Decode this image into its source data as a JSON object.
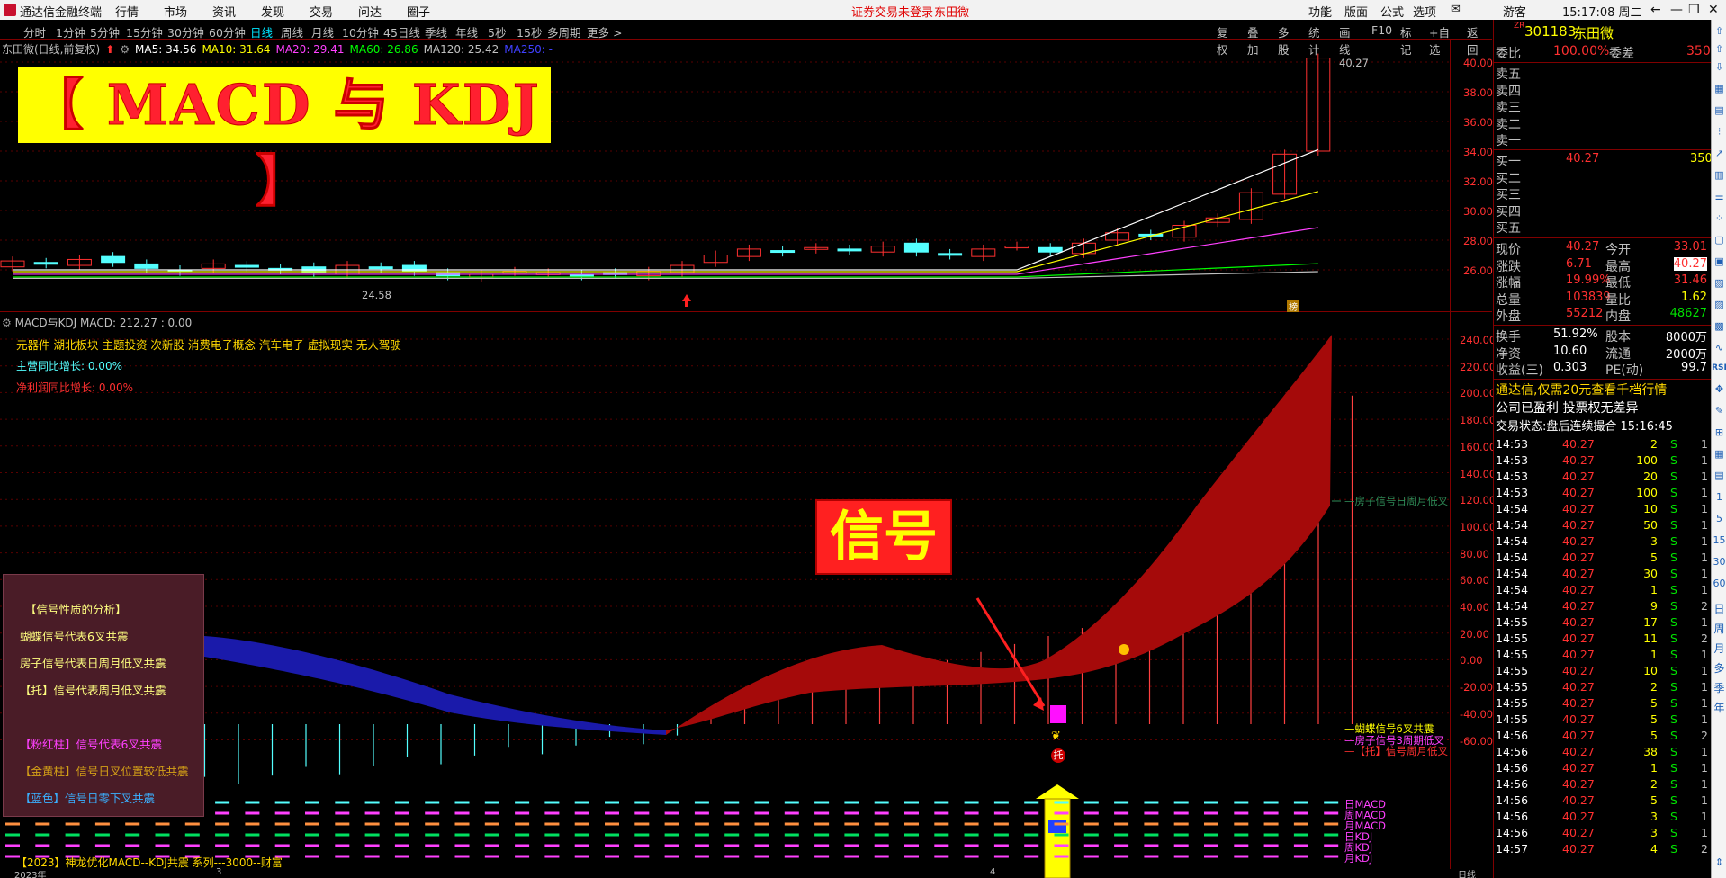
{
  "titlebar": {
    "app_name": "通达信金融终端",
    "menu": [
      "行情",
      "市场",
      "资讯",
      "发现",
      "交易",
      "问达",
      "圈子"
    ],
    "warning": "证券交易未登录",
    "stock": "东田微",
    "right": [
      "功能",
      "版面",
      "公式",
      "选项"
    ],
    "user": "游客",
    "time": "15:17:08 周二"
  },
  "timeframes": [
    "分时",
    "1分钟",
    "5分钟",
    "15分钟",
    "30分钟",
    "60分钟",
    "日线",
    "周线",
    "月线",
    "10分钟",
    "45日线",
    "季线",
    "年线",
    "5秒",
    "15秒",
    "多周期",
    "更多 >"
  ],
  "active_timeframe": "日线",
  "toolbar_right": [
    "复权",
    "叠加",
    "多股",
    "统计",
    "画线",
    "F10",
    "标记",
    "+自选",
    "返回"
  ],
  "ma_line": {
    "name": "东田微(日线,前复权)",
    "ma5": "MA5: 34.56",
    "ma10": "MA10: 31.64",
    "ma20": "MA20: 29.41",
    "ma60": "MA60: 26.86",
    "ma120": "MA120: 25.42",
    "ma250": "MA250: -"
  },
  "banner": "【 MACD 与 KDJ 】",
  "price_axis": [
    "40.00",
    "38.00",
    "36.00",
    "34.00",
    "32.00",
    "30.00",
    "28.00",
    "26.00"
  ],
  "high_label": "40.27",
  "low_label": "24.58",
  "badge_text": "榜",
  "indicator": {
    "title": "MACD与KDJ",
    "macd_label": "MACD: 212.27",
    "macd_extra": ": 0.00",
    "concepts": "元器件 湖北板块 主题投资 次新股 消费电子概念 汽车电子 虚拟现实 无人驾驶",
    "revenue_growth": "主营同比增长: 0.00%",
    "profit_growth": "净利润同比增长: 0.00%"
  },
  "macd_axis": [
    "240.00",
    "220.00",
    "200.00",
    "180.00",
    "160.00",
    "140.00",
    "120.00",
    "100.00",
    "80.00",
    "60.00",
    "40.00",
    "20.00",
    "0.00",
    "-20.00",
    "-40.00",
    "-60.00"
  ],
  "signal_box": "信号",
  "legend_box": {
    "title": "【信号性质的分析】",
    "l1": "蝴蝶信号代表6叉共震",
    "l2": "房子信号代表日周月低叉共震",
    "l3": "【托】信号代表周月低叉共震",
    "l4": "【粉红柱】信号代表6叉共震",
    "l5": "【金黄柱】信号日叉位置较低共震",
    "l6": "【蓝色】信号日零下叉共震"
  },
  "right_labels": {
    "house": "—房子信号日周月低叉",
    "butterfly": "—蝴蝶信号6叉共震",
    "house2": "—房子信号3周期低叉",
    "tuo": "—【托】信号周月低叉",
    "tuo_mark": "托",
    "rows": [
      "日MACD",
      "周MACD",
      "月MACD",
      "日KDJ",
      "周KDJ",
      "月KDJ"
    ]
  },
  "bottom_label": "【2023】神龙优化MACD--KDJ共震 系列---3000--财富",
  "date_bar": {
    "year": "2023年",
    "mid": "3",
    "right": "4",
    "axis": "日线"
  },
  "quote": {
    "flag": "ZR",
    "code": "301183",
    "name": "东田微",
    "weibi_label": "委比",
    "weibi": "100.00%",
    "weicha_label": "委差",
    "weicha": "350",
    "sell": [
      "卖五",
      "卖四",
      "卖三",
      "卖二",
      "卖一"
    ],
    "buy": [
      {
        "label": "买一",
        "price": "40.27",
        "vol": "350"
      },
      {
        "label": "买二",
        "price": "",
        "vol": ""
      },
      {
        "label": "买三",
        "price": "",
        "vol": ""
      },
      {
        "label": "买四",
        "price": "",
        "vol": ""
      },
      {
        "label": "买五",
        "price": "",
        "vol": ""
      }
    ],
    "stats": [
      [
        "现价",
        "40.27",
        "今开",
        "33.01"
      ],
      [
        "涨跌",
        "6.71",
        "最高",
        "40.27"
      ],
      [
        "涨幅",
        "19.99%",
        "最低",
        "31.46"
      ],
      [
        "总量",
        "103839",
        "量比",
        "1.62"
      ],
      [
        "外盘",
        "55212",
        "内盘",
        "48627"
      ]
    ],
    "fund": [
      [
        "换手",
        "51.92%",
        "股本",
        "8000万"
      ],
      [
        "净资",
        "10.60",
        "流通",
        "2000万"
      ],
      [
        "收益(三)",
        "0.303",
        "PE(动)",
        "99.7"
      ]
    ],
    "promo1": "通达信,仅需20元查看千档行情",
    "promo2": "公司已盈利 投票权无差异",
    "trade_status": "交易状态:盘后连续撮合 15:16:45"
  },
  "ticks": [
    [
      "14:53",
      "40.27",
      "2",
      "S",
      "1"
    ],
    [
      "14:53",
      "40.27",
      "100",
      "S",
      "1"
    ],
    [
      "14:53",
      "40.27",
      "20",
      "S",
      "1"
    ],
    [
      "14:53",
      "40.27",
      "100",
      "S",
      "1"
    ],
    [
      "14:54",
      "40.27",
      "10",
      "S",
      "1"
    ],
    [
      "14:54",
      "40.27",
      "50",
      "S",
      "1"
    ],
    [
      "14:54",
      "40.27",
      "3",
      "S",
      "1"
    ],
    [
      "14:54",
      "40.27",
      "5",
      "S",
      "1"
    ],
    [
      "14:54",
      "40.27",
      "30",
      "S",
      "1"
    ],
    [
      "14:54",
      "40.27",
      "1",
      "S",
      "1"
    ],
    [
      "14:54",
      "40.27",
      "9",
      "S",
      "2"
    ],
    [
      "14:55",
      "40.27",
      "17",
      "S",
      "1"
    ],
    [
      "14:55",
      "40.27",
      "11",
      "S",
      "2"
    ],
    [
      "14:55",
      "40.27",
      "1",
      "S",
      "1"
    ],
    [
      "14:55",
      "40.27",
      "10",
      "S",
      "1"
    ],
    [
      "14:55",
      "40.27",
      "2",
      "S",
      "1"
    ],
    [
      "14:55",
      "40.27",
      "5",
      "S",
      "1"
    ],
    [
      "14:55",
      "40.27",
      "5",
      "S",
      "1"
    ],
    [
      "14:56",
      "40.27",
      "5",
      "S",
      "2"
    ],
    [
      "14:56",
      "40.27",
      "38",
      "S",
      "1"
    ],
    [
      "14:56",
      "40.27",
      "1",
      "S",
      "1"
    ],
    [
      "14:56",
      "40.27",
      "2",
      "S",
      "1"
    ],
    [
      "14:56",
      "40.27",
      "5",
      "S",
      "1"
    ],
    [
      "14:56",
      "40.27",
      "3",
      "S",
      "1"
    ],
    [
      "14:56",
      "40.27",
      "3",
      "S",
      "1"
    ],
    [
      "14:57",
      "40.27",
      "4",
      "S",
      "2"
    ]
  ],
  "sidebar_text": [
    "日",
    "周",
    "月",
    "多",
    "季",
    "年"
  ],
  "colors": {
    "up": "#ff3030",
    "down": "#54ffff",
    "yellow": "#ffff00",
    "macd_red": "#a50a0a",
    "macd_blue": "#1a1aaa"
  }
}
